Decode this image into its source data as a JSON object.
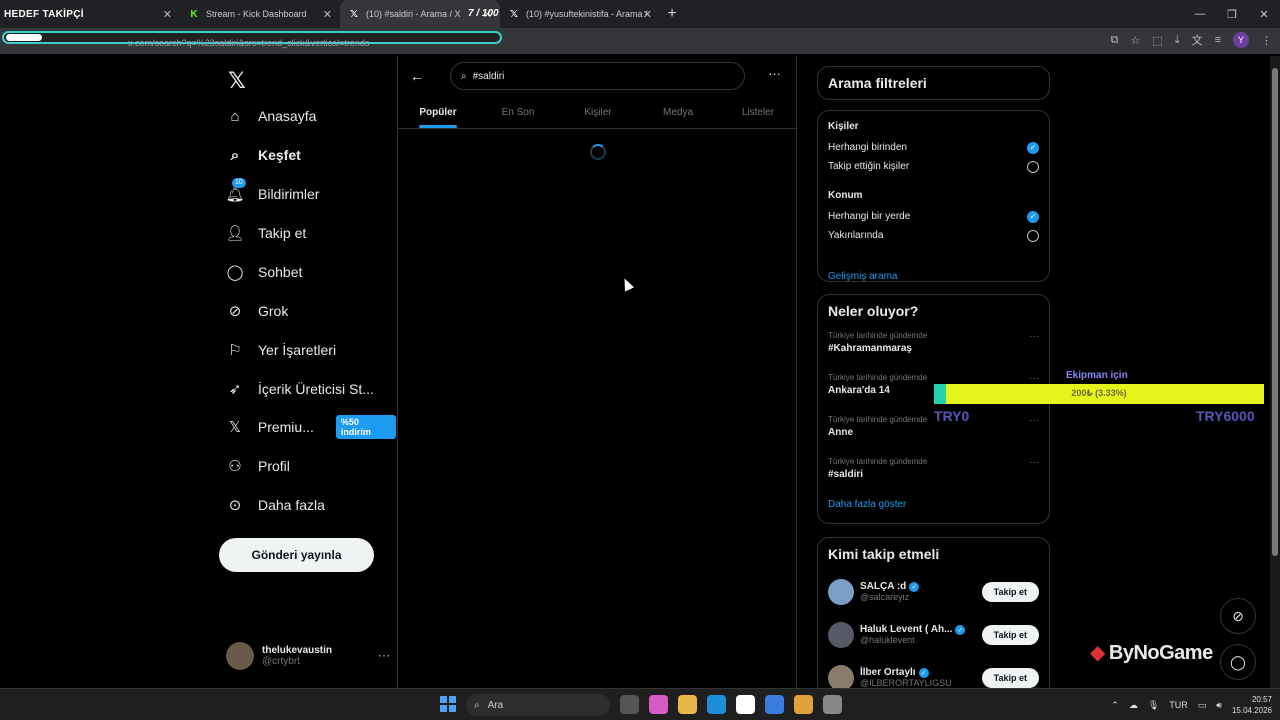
{
  "browser": {
    "tabs": [
      {
        "label": "HEDEF TAKİPÇİ",
        "icon": "brand-logo"
      },
      {
        "label": "Stream - Kick Dashboard",
        "icon": "kick-icon"
      },
      {
        "label": "(10) #saldiri - Arama / X",
        "icon": "x-icon",
        "active": true
      },
      {
        "label": "(10) #yusuftekinistifa - Arama /",
        "icon": "x-icon"
      }
    ],
    "tab_counter": "7 / 100",
    "url": "x.com/search?q=%23saldiri&src=trend_click&vertical=trends"
  },
  "nav": {
    "items": [
      {
        "label": "Anasayfa",
        "icon": "home-icon"
      },
      {
        "label": "Keşfet",
        "icon": "search-icon"
      },
      {
        "label": "Bildirimler",
        "icon": "bell-icon",
        "badge": "10"
      },
      {
        "label": "Takip et",
        "icon": "add-person-icon"
      },
      {
        "label": "Sohbet",
        "icon": "chat-icon"
      },
      {
        "label": "Grok",
        "icon": "grok-icon"
      },
      {
        "label": "Yer İşaretleri",
        "icon": "bookmark-icon"
      },
      {
        "label": "İçerik Üreticisi St...",
        "icon": "rocket-icon"
      },
      {
        "label": "Premiu...",
        "icon": "x-icon",
        "badge": "%50 indirim"
      },
      {
        "label": "Profil",
        "icon": "person-icon"
      },
      {
        "label": "Daha fazla",
        "icon": "more-circle-icon"
      }
    ],
    "post_button": "Gönderi yayınla",
    "account": {
      "name": "thelukevaustin",
      "handle": "@crtybrt"
    }
  },
  "search": {
    "value": "#saldiri",
    "tabs": [
      "Popüler",
      "En Son",
      "Kişiler",
      "Medya",
      "Listeler"
    ],
    "active_tab": "Popüler"
  },
  "filters": {
    "title": "Arama filtreleri",
    "people_head": "Kişiler",
    "people_options": [
      {
        "label": "Herhangi birinden",
        "selected": true
      },
      {
        "label": "Takip ettiğin kişiler",
        "selected": false
      }
    ],
    "location_head": "Konum",
    "location_options": [
      {
        "label": "Herhangi bir yerde",
        "selected": true
      },
      {
        "label": "Yakınlarında",
        "selected": false
      }
    ],
    "advanced_link": "Gelişmiş arama"
  },
  "trends": {
    "title": "Neler oluyor?",
    "items": [
      {
        "meta": "Türkiye tarihinde gündemde",
        "name": "#Kahramanmaraş"
      },
      {
        "meta": "Türkiye tarihinde gündemde",
        "name": "Ankara'da 14"
      },
      {
        "meta": "Türkiye tarihinde gündemde",
        "name": "Anne"
      },
      {
        "meta": "Türkiye tarihinde gündemde",
        "name": "#saldiri"
      }
    ],
    "show_more": "Daha fazla göster"
  },
  "who_to_follow": {
    "title": "Kimi takip etmeli",
    "items": [
      {
        "name": "SALÇA :d",
        "handle": "@salcareyiz",
        "button": "Takip et",
        "avatar_color": "#7aa0c8"
      },
      {
        "name": "Haluk Levent ( Ah...",
        "handle": "@haluklevent",
        "button": "Takip et",
        "avatar_color": "#555a66"
      },
      {
        "name": "İlber Ortaylı",
        "handle": "@ILBERORTAYLIGSU",
        "button": "Takip et",
        "avatar_color": "#8a7a6a"
      }
    ]
  },
  "overlay": {
    "donation_title": "Ekipman için",
    "donation_text": "200₺ (3.33%)",
    "donation_progress_pct": 3.33,
    "min_label": "TRY0",
    "max_label": "TRY6000",
    "sponsor": "ByNoGame"
  },
  "taskbar": {
    "search_placeholder": "Ara",
    "lang": "TUR",
    "time": "20:57",
    "date": "15.04.2026"
  },
  "colors": {
    "accent": "#1d9bf0",
    "donation_bar": "#e5f51b",
    "donation_fill": "#22d3b0",
    "donation_labels": "#5a55b8"
  }
}
